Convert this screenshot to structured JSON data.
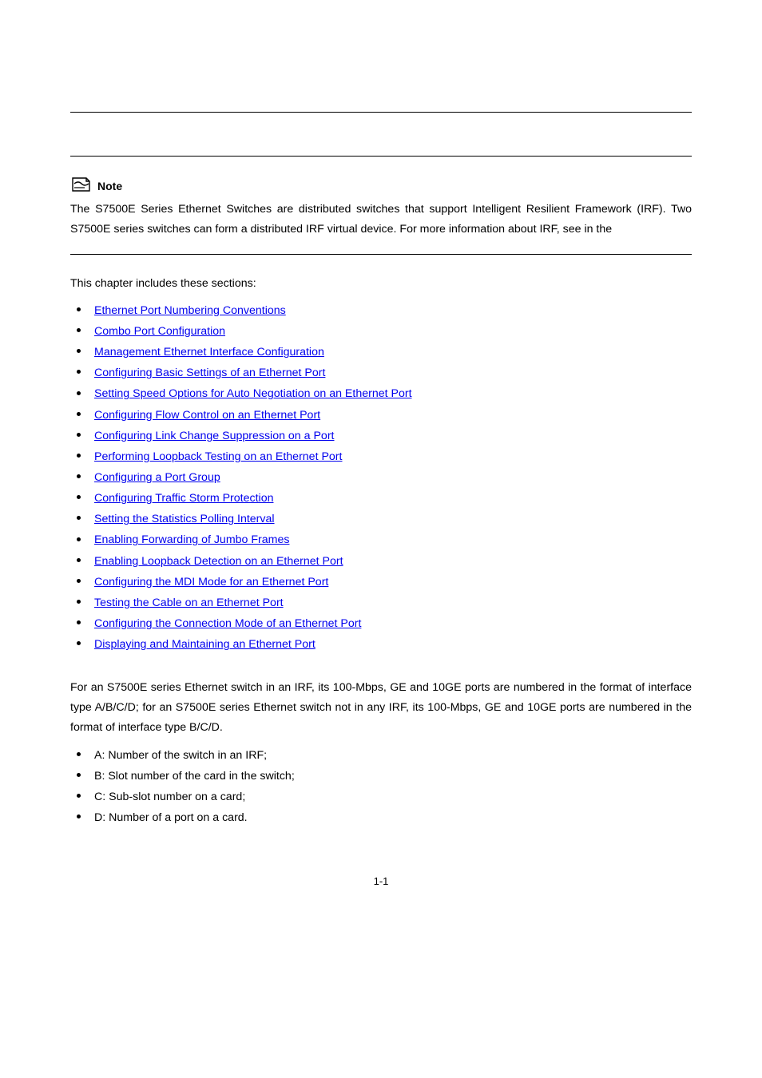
{
  "note": {
    "label": "Note",
    "paragraph_prefix": "The S7500E Series Ethernet Switches are distributed switches that support Intelligent Resilient Framework (IRF). Two S7500E series switches can form a distributed IRF virtual device. For more information about IRF, see ",
    "paragraph_mid": " in the "
  },
  "intro": "This chapter includes these sections:",
  "toc": [
    "Ethernet Port Numbering Conventions",
    "Combo Port Configuration",
    "Management Ethernet Interface Configuration",
    "Configuring Basic Settings of an Ethernet Port",
    "Setting Speed Options for Auto Negotiation on an Ethernet Port",
    "Configuring Flow Control on an Ethernet Port",
    "Configuring Link Change Suppression on a Port",
    "Performing Loopback Testing on an Ethernet Port",
    "Configuring a Port Group",
    "Configuring Traffic Storm Protection",
    "Setting the Statistics Polling Interval",
    "Enabling Forwarding of Jumbo Frames",
    "Enabling Loopback Detection on an Ethernet Port",
    "Configuring the MDI Mode for an Ethernet Port",
    "Testing the Cable on an Ethernet Port",
    "Configuring the Connection Mode of an Ethernet Port",
    "Displaying and Maintaining an Ethernet Port"
  ],
  "section": {
    "body": "For an S7500E series Ethernet switch in an IRF, its 100-Mbps, GE and 10GE ports are numbered in the format of interface type A/B/C/D; for an S7500E series Ethernet switch not in any IRF, its 100-Mbps, GE and 10GE ports are numbered in the format of interface type B/C/D.",
    "items": [
      "A: Number of the switch in an IRF;",
      "B: Slot number of the card in the switch;",
      "C: Sub-slot number on a card;",
      "D: Number of a port on a card."
    ]
  },
  "pagenum": "1-1"
}
